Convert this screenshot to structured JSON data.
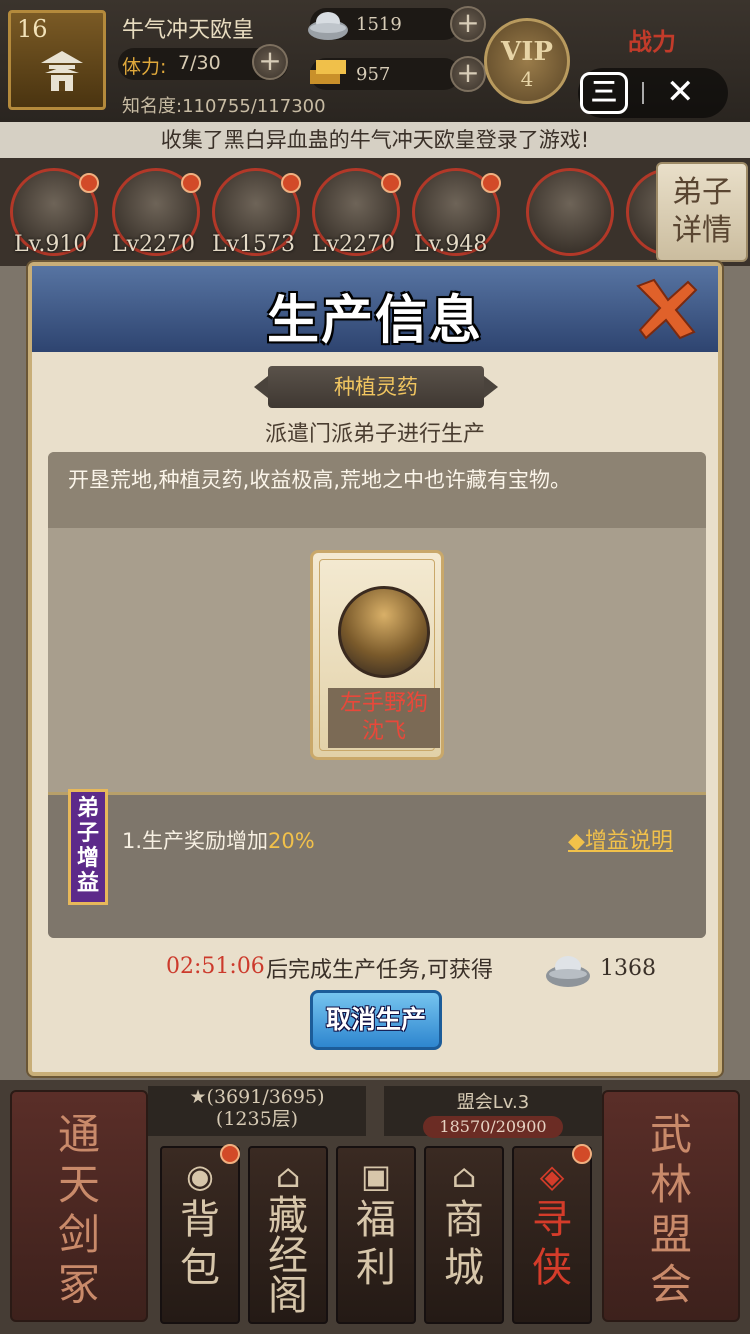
{
  "hud": {
    "sect_level": "16",
    "player_name": "牛气冲天欧皇",
    "stamina_label": "体力:",
    "stamina_value": "7/30",
    "fame_label": "知名度:",
    "fame_value": "110755/117300",
    "silver": "1519",
    "gold": "957",
    "vip_label": "VIP",
    "vip_level": "4",
    "power_label": "战力"
  },
  "broadcast": "收集了黑白异血蛊的牛气冲天欧皇登录了游戏!",
  "disciples": [
    {
      "level": "Lv.910"
    },
    {
      "level": "Lv2270"
    },
    {
      "level": "Lv1573"
    },
    {
      "level": "Lv2270"
    },
    {
      "level": "Lv.948"
    },
    {
      "level": ""
    },
    {
      "level": ""
    }
  ],
  "detail_button": "弟子详情",
  "modal": {
    "title": "生产信息",
    "tag": "种植灵药",
    "subtitle": "派遣门派弟子进行生产",
    "description": "开垦荒地,种植灵药,收益极高,荒地之中也许藏有宝物。",
    "disciple_name_line1": "左手野狗",
    "disciple_name_line2": "沈飞",
    "bonus_tag": "弟子增益",
    "bonus_line": "1.生产奖励增加",
    "bonus_pct": "20%",
    "bonus_help": "◆增益说明",
    "timer": "02:51:06",
    "footer_text": "后完成生产任务,可获得",
    "reward_value": "1368",
    "cancel_button": "取消生产"
  },
  "bottom": {
    "tower_progress": "(3691/3695)",
    "tower_floor": "(1235层)",
    "alliance_lv": "盟会Lv.3",
    "alliance_exp": "18570/20900",
    "left_big": "通天剑冢",
    "right_big": "武林盟会",
    "nav": [
      {
        "label": "背包",
        "icon": "bag-icon",
        "glyph": "◉"
      },
      {
        "label": "藏经阁",
        "icon": "pagoda-icon",
        "glyph": "⌂"
      },
      {
        "label": "福利",
        "icon": "gift-icon",
        "glyph": "▣"
      },
      {
        "label": "商城",
        "icon": "shop-icon",
        "glyph": "⌂"
      },
      {
        "label": "寻侠",
        "icon": "search-hero-icon",
        "glyph": "◈"
      }
    ]
  },
  "colors": {
    "accent_gold": "#f2c14a",
    "timer_red": "#cc3a2c",
    "header_blue": "#2e4470",
    "cancel_blue": "#2e86cf"
  }
}
